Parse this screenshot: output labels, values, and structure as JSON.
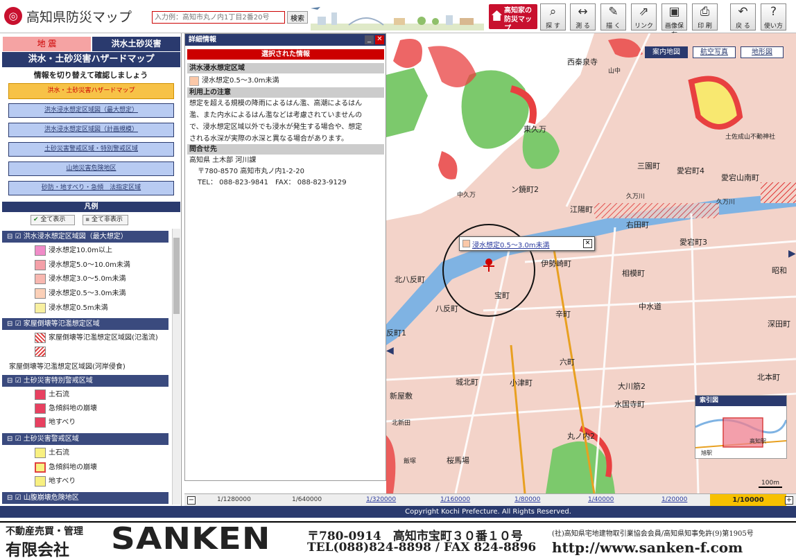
{
  "header": {
    "title": "高知県防災マップ",
    "search_placeholder": "入力例：高知市丸ノ内1丁目2番20号",
    "search_button": "検索",
    "brand_line1": "高知家の",
    "brand_line2": "防災マップ",
    "tools": [
      {
        "label": "探 す",
        "icon": "search-icon",
        "glyph": "⌕"
      },
      {
        "label": "測 る",
        "icon": "ruler-icon",
        "glyph": "↔"
      },
      {
        "label": "描 く",
        "icon": "draw-icon",
        "glyph": "✎"
      },
      {
        "label": "リンク",
        "icon": "link-icon",
        "glyph": "⇗"
      },
      {
        "label": "画像保存",
        "icon": "save-image-icon",
        "glyph": "▣"
      },
      {
        "label": "印 刷",
        "icon": "print-icon",
        "glyph": "⎙"
      },
      {
        "label": "戻 る",
        "icon": "back-icon",
        "glyph": "↶"
      },
      {
        "label": "使い方",
        "icon": "help-icon",
        "glyph": "?"
      }
    ]
  },
  "left_panel": {
    "tabs": [
      "地 震",
      "洪水土砂災害"
    ],
    "title": "洪水・土砂災害ハザードマップ",
    "subtitle": "情報を切り替えて確認しましょう",
    "map_buttons": [
      "洪水・土砂災害ハザードマップ",
      "洪水浸水想定区域図（最大想定）",
      "洪水浸水想定区域図（計画規模）",
      "土砂災害警戒区域・特別警戒区域",
      "山地災害危険地区",
      "砂防・地すべり・急傾　法指定区域"
    ],
    "legend": {
      "header": "凡例",
      "show_all": "全て表示",
      "hide_all": "全て非表示",
      "groups": [
        {
          "title": "洪水浸水想定区域図（最大想定）",
          "items": [
            {
              "label": "浸水想定10.0m以上",
              "color": "#f08cc8"
            },
            {
              "label": "浸水想定5.0～10.0m未満",
              "color": "#f4a0a8"
            },
            {
              "label": "浸水想定3.0～5.0m未満",
              "color": "#f8b8b0"
            },
            {
              "label": "浸水想定0.5～3.0m未満",
              "color": "#fbd0b8"
            },
            {
              "label": "浸水想定0.5m未満",
              "color": "#f8f0a0"
            }
          ]
        },
        {
          "title": "家屋倒壊等氾濫想定区域",
          "items": [
            {
              "label": "家屋倒壊等氾濫想定区域図(氾濫流)",
              "color": "#e04040"
            },
            {
              "label": "",
              "color": "#e04040"
            }
          ],
          "note": "家屋倒壊等氾濫想定区域図(河岸侵食)"
        },
        {
          "title": "土砂災害特別警戒区域",
          "items": [
            {
              "label": "土石流",
              "color": "#e84060"
            },
            {
              "label": "急傾斜地の崩壊",
              "color": "#e84060"
            },
            {
              "label": "地すべり",
              "color": "#e84060"
            }
          ]
        },
        {
          "title": "土砂災害警戒区域",
          "items": [
            {
              "label": "土石流",
              "color": "#f8f080"
            },
            {
              "label": "急傾斜地の崩壊",
              "color": "#f8f080"
            },
            {
              "label": "地すべり",
              "color": "#f8f080"
            }
          ]
        },
        {
          "title": "山腹崩壊危険地区",
          "items": []
        }
      ]
    }
  },
  "detail": {
    "title": "詳細情報",
    "selected_header": "選択された情報",
    "section1": "洪水浸水想定区域",
    "value1": "浸水想定0.5～3.0m未満",
    "value1_color": "#fbc8a8",
    "section2": "利用上の注意",
    "note_lines": [
      "想定を超える規模の降雨によるはん濫、高潮によるはん",
      "濫、また内水によるはん濫などは考慮されていませんの",
      "で、浸水想定区域以外でも浸水が発生する場合や、想定",
      "される水深が実際の水深と異なる場合があります。"
    ],
    "section3": "問合せ先",
    "contact_lines": [
      "高知県 土木部 河川課",
      "〒780-8570 高知市丸ノ内1-2-20",
      "TEL： 088-823-9841　FAX： 088-823-9129"
    ]
  },
  "map": {
    "basemap_buttons": [
      "案内地図",
      "航空写真",
      "地形図"
    ],
    "popup_text": "浸水想定0.5～3.0m未満",
    "index_title": "索引図",
    "index_labels": [
      "高知駅",
      "旭駅"
    ],
    "scale_text": "100m",
    "places": [
      {
        "n": "西秦泉寺"
      },
      {
        "n": "山中"
      },
      {
        "n": "東久万"
      },
      {
        "n": "三園町"
      },
      {
        "n": "愛宕町4"
      },
      {
        "n": "愛宕山南町"
      },
      {
        "n": "久万川"
      },
      {
        "n": "ン鏡町2"
      },
      {
        "n": "中久万"
      },
      {
        "n": "江陽町"
      },
      {
        "n": "右田町"
      },
      {
        "n": "愛宕町3"
      },
      {
        "n": "伊勢崎町"
      },
      {
        "n": "相模町"
      },
      {
        "n": "北八反町"
      },
      {
        "n": "宝町"
      },
      {
        "n": "八反町"
      },
      {
        "n": "中水道"
      },
      {
        "n": "辛町"
      },
      {
        "n": "反町1"
      },
      {
        "n": "六町"
      },
      {
        "n": "昭和"
      },
      {
        "n": "深田町"
      },
      {
        "n": "小津町"
      },
      {
        "n": "城北町"
      },
      {
        "n": "新屋敷"
      },
      {
        "n": "大川筋2"
      },
      {
        "n": "北本町"
      },
      {
        "n": "水国寺町"
      },
      {
        "n": "丸ノ内2"
      },
      {
        "n": "桜馬場"
      },
      {
        "n": "土佐成山不動神社"
      },
      {
        "n": "久万川"
      },
      {
        "n": "飯塚"
      },
      {
        "n": "北新田"
      }
    ]
  },
  "scales": [
    "1/1280000",
    "1/640000",
    "1/320000",
    "1/160000",
    "1/80000",
    "1/40000",
    "1/20000",
    "1/10000"
  ],
  "copyright": "Copyright Kochi Prefecture. All Rights Reserved.",
  "ad": {
    "business": "不動産売買・管理",
    "company_type": "有限会社",
    "name": "SANKEN",
    "address": "〒780-0914　高知市宝町３０番１０号",
    "tel": "TEL(088)824-8898 / FAX 824-8896",
    "association": "(社)高知県宅地建物取引業協会会員/高知県知事免許(9)第1905号",
    "url": "http://www.sanken-f.com"
  },
  "colors": {
    "navy": "#2a3a6e",
    "red": "#c8102e",
    "accent": "#f7c247"
  }
}
